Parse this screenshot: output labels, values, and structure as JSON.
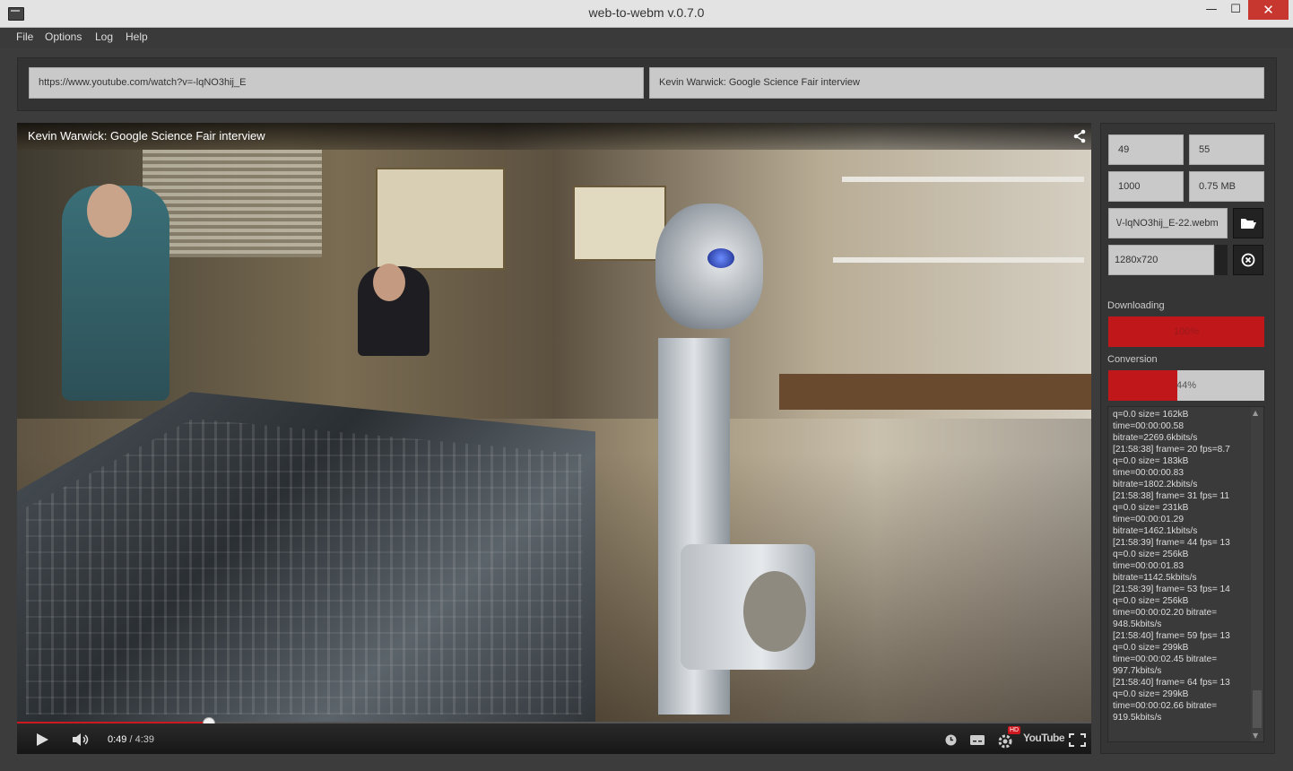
{
  "window": {
    "title": "web-to-webm v.0.7.0",
    "minimize_glyph": "—",
    "maximize_glyph": "☐",
    "close_glyph": "✕"
  },
  "menu": [
    "File",
    "Options",
    "Log",
    "Help"
  ],
  "url_input": {
    "value": "https://www.youtube.com/watch?v=-lqNO3hij_E"
  },
  "title_input": {
    "value": "Kevin Warwick: Google Science Fair interview"
  },
  "video": {
    "title": "Kevin Warwick: Google Science Fair interview",
    "current_time": "0:49",
    "separator": " / ",
    "duration": "4:39",
    "played_fraction": 0.179,
    "hd_badge": "HD",
    "youtube_logo": "YouTube"
  },
  "settings": {
    "start": "49",
    "end": "55",
    "bitrate": "1000",
    "size": "0.75 MB",
    "output_path": "\\/-lqNO3hij_E-22.webm",
    "resolution": "1280x720"
  },
  "progress": {
    "downloading_label": "Downloading",
    "downloading_percent": "100%",
    "downloading_fraction": 1.0,
    "conversion_label": "Conversion",
    "conversion_percent": "44%",
    "conversion_fraction": 0.44
  },
  "log_lines": [
    "q=0.0 size= 162kB",
    "time=00:00:00.58",
    "bitrate=2269.6kbits/s",
    "[21:58:38] frame= 20 fps=8.7",
    "q=0.0 size= 183kB",
    "time=00:00:00.83",
    "bitrate=1802.2kbits/s",
    "[21:58:38] frame= 31 fps= 11",
    "q=0.0 size= 231kB",
    "time=00:00:01.29",
    "bitrate=1462.1kbits/s",
    "[21:58:39] frame= 44 fps= 13",
    "q=0.0 size= 256kB",
    "time=00:00:01.83",
    "bitrate=1142.5kbits/s",
    "[21:58:39] frame= 53 fps= 14",
    "q=0.0 size= 256kB",
    "time=00:00:02.20 bitrate=",
    "948.5kbits/s",
    "[21:58:40] frame= 59 fps= 13",
    "q=0.0 size= 299kB",
    "time=00:00:02.45 bitrate=",
    "997.7kbits/s",
    "[21:58:40] frame= 64 fps= 13",
    "q=0.0 size= 299kB",
    "time=00:00:02.66 bitrate=",
    "919.5kbits/s"
  ],
  "colors": {
    "accent_red": "#c0171b",
    "youtube_red": "#cc181e",
    "panel_bg": "#353535",
    "field_bg": "#c9c9c9"
  },
  "icons": {
    "open_folder": "folder-open-icon",
    "cancel": "cancel-icon",
    "share": "share-icon",
    "play": "play-icon",
    "volume": "volume-icon",
    "watch_later": "clock-icon",
    "captions": "captions-icon",
    "settings": "gear-icon",
    "fullscreen": "fullscreen-icon"
  }
}
